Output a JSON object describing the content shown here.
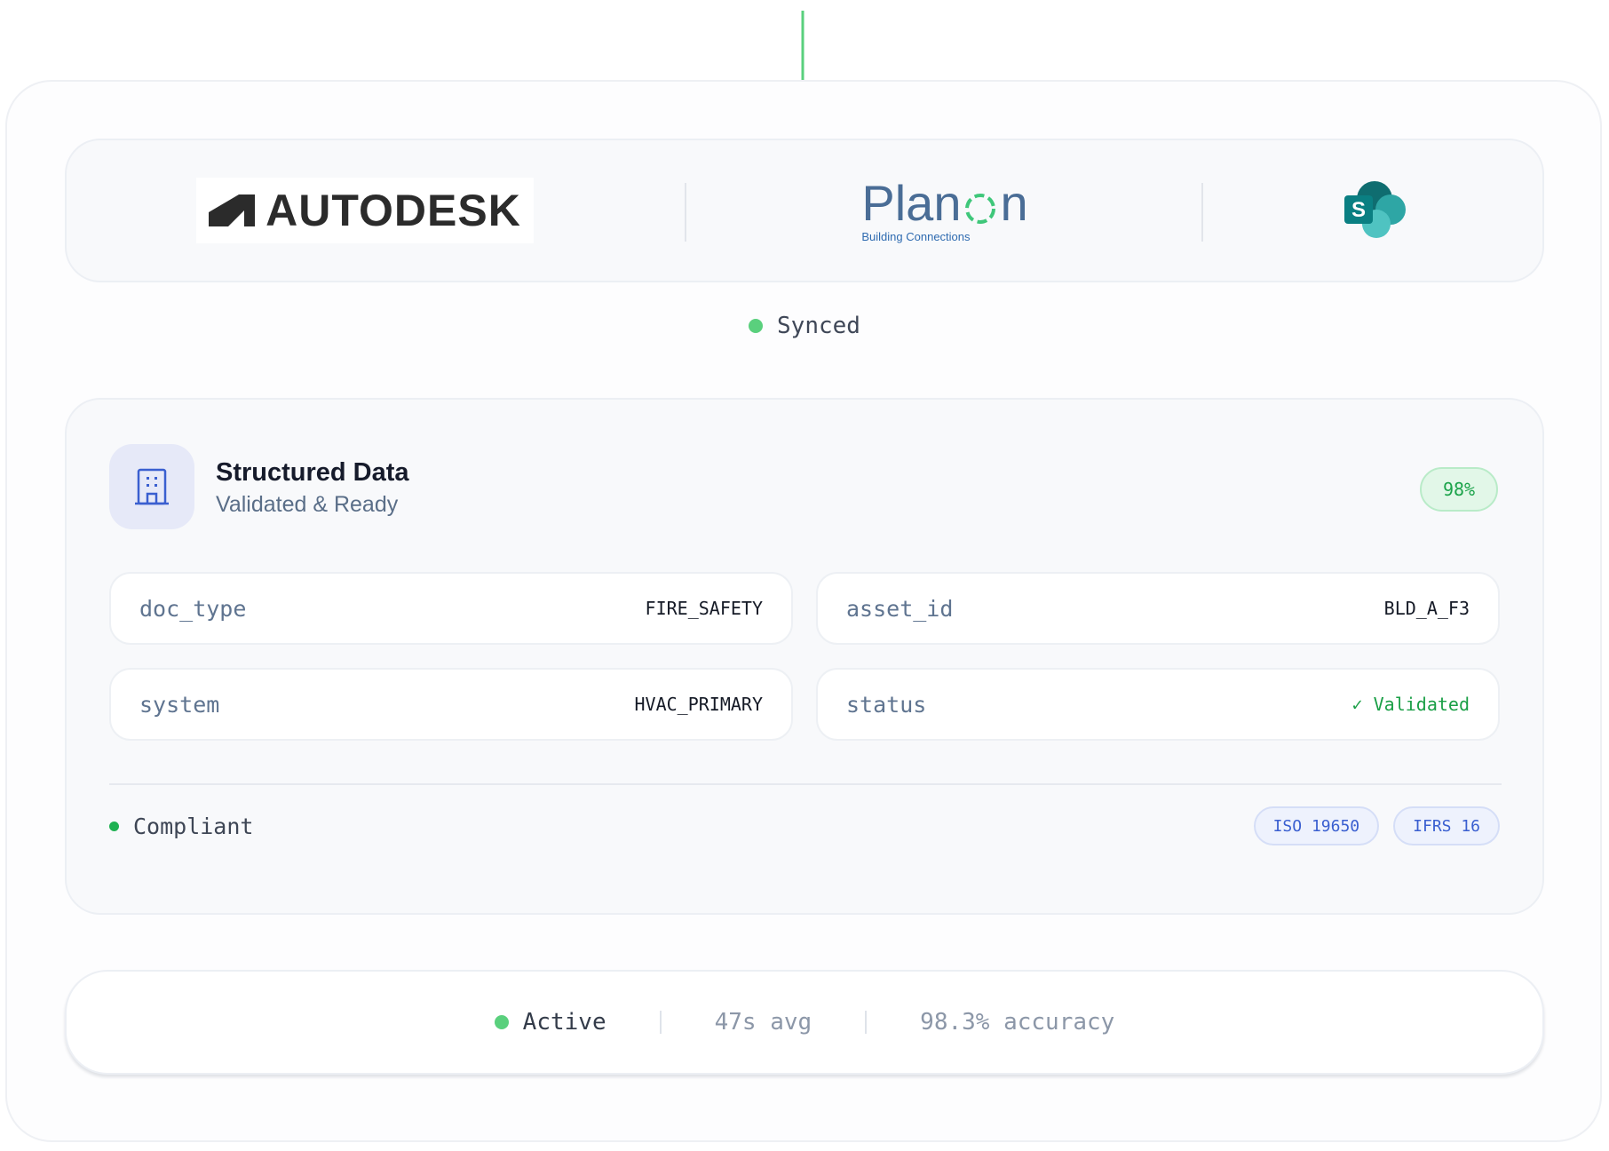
{
  "integrations": {
    "autodesk": {
      "name": "AUTODESK"
    },
    "planon": {
      "name_left": "Plan",
      "name_right": "n",
      "tagline": "Building Connections"
    },
    "sharepoint": {
      "glyph": "S"
    }
  },
  "sync": {
    "label": "Synced",
    "status_color": "#5ad07d"
  },
  "structured_data": {
    "icon": "building-icon",
    "title": "Structured Data",
    "subtitle": "Validated & Ready",
    "score": "98%",
    "fields": [
      {
        "key": "doc_type",
        "value": "FIRE_SAFETY"
      },
      {
        "key": "asset_id",
        "value": "BLD_A_F3"
      },
      {
        "key": "system",
        "value": "HVAC_PRIMARY"
      },
      {
        "key": "status",
        "value": "✓ Validated"
      }
    ],
    "compliance": {
      "label": "Compliant",
      "badges": [
        "ISO 19650",
        "IFRS 16"
      ]
    }
  },
  "metrics": {
    "active": "Active",
    "avg": "47s avg",
    "accuracy": "98.3% accuracy"
  },
  "colors": {
    "accent_green": "#5ad07d",
    "badge_blue": "#3a5fd0",
    "title": "#161b2b"
  }
}
